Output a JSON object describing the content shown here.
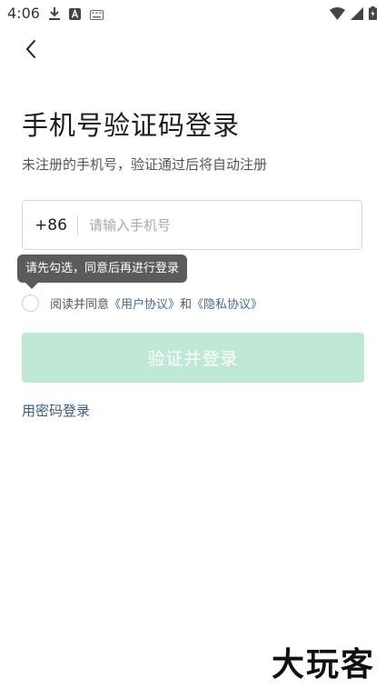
{
  "status_bar": {
    "time": "4:06",
    "left_icons": [
      "download-icon",
      "app-a-icon",
      "keyboard-icon"
    ],
    "right_icons": [
      "wifi-icon",
      "signal-icon",
      "battery-charging-icon"
    ]
  },
  "header": {
    "back_icon": "chevron-left-icon"
  },
  "page": {
    "title": "手机号验证码登录",
    "subtitle": "未注册的手机号，验证通过后将自动注册"
  },
  "phone_field": {
    "country_code": "+86",
    "placeholder": "请输入手机号",
    "value": ""
  },
  "tooltip": {
    "text": "请先勾选，同意后再进行登录"
  },
  "agreement": {
    "prefix": "阅读并同意",
    "user_agreement": "《用户协议》",
    "and": "和",
    "privacy_policy": "《隐私协议》",
    "checked": false
  },
  "login_button": {
    "label": "验证并登录"
  },
  "password_login": {
    "label": "用密码登录"
  },
  "watermark": {
    "text": "大玩客"
  },
  "colors": {
    "button_disabled": "#bfe9d5",
    "link": "#4a6a8c",
    "tooltip_bg": "#5b5b5b"
  }
}
